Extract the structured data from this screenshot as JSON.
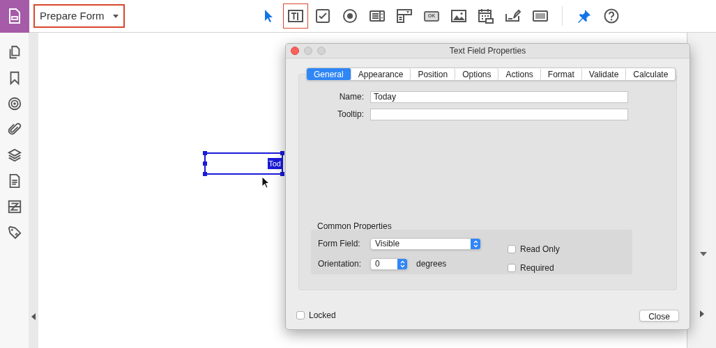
{
  "toolbar": {
    "tool_menu": {
      "label": "Prepare Form",
      "highlighted": true
    },
    "tools": [
      {
        "kind": "select",
        "selected": false
      },
      {
        "kind": "textfield",
        "selected": true
      },
      {
        "kind": "checkbox",
        "selected": false
      },
      {
        "kind": "radio",
        "selected": false
      },
      {
        "kind": "listbox",
        "selected": false
      },
      {
        "kind": "dropdown",
        "selected": false
      },
      {
        "kind": "button",
        "label": "OK",
        "selected": false
      },
      {
        "kind": "image",
        "selected": false
      },
      {
        "kind": "date",
        "selected": false
      },
      {
        "kind": "signature",
        "selected": false
      },
      {
        "kind": "barcode",
        "selected": false
      },
      {
        "kind": "pin",
        "selected": false
      },
      {
        "kind": "help",
        "selected": false
      }
    ]
  },
  "sidebar": {
    "items": [
      {
        "kind": "pages"
      },
      {
        "kind": "bookmark"
      },
      {
        "kind": "target"
      },
      {
        "kind": "attachment"
      },
      {
        "kind": "layers"
      },
      {
        "kind": "document"
      },
      {
        "kind": "compare"
      },
      {
        "kind": "tag"
      }
    ]
  },
  "canvas": {
    "field": {
      "text": "Tod",
      "selected": true
    }
  },
  "dialog": {
    "title": "Text Field Properties",
    "tabs": [
      {
        "label": "General",
        "selected": true
      },
      {
        "label": "Appearance",
        "selected": false
      },
      {
        "label": "Position",
        "selected": false
      },
      {
        "label": "Options",
        "selected": false
      },
      {
        "label": "Actions",
        "selected": false
      },
      {
        "label": "Format",
        "selected": false
      },
      {
        "label": "Validate",
        "selected": false
      },
      {
        "label": "Calculate",
        "selected": false
      }
    ],
    "fields": [
      {
        "label": "Name:",
        "value": "Today"
      },
      {
        "label": "Tooltip:"
      }
    ],
    "common_properties": {
      "title": "Common Properties",
      "form_field": {
        "label": "Form Field:",
        "value": "Visible"
      },
      "orientation": {
        "label": "Orientation:",
        "value": "0",
        "unit": "degrees"
      },
      "checkboxes": [
        {
          "label": "Read Only",
          "checked": false
        },
        {
          "label": "Required",
          "checked": false
        }
      ]
    },
    "locked": {
      "label": "Locked",
      "checked": false
    },
    "close_button": "Close"
  }
}
